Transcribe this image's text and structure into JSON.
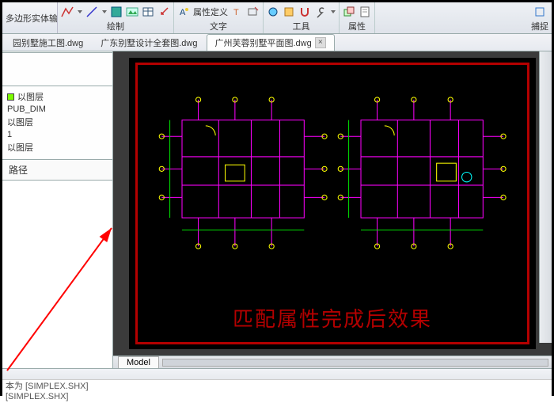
{
  "ribbon": {
    "left_label": "多边形实体输入",
    "groups": [
      {
        "label": "绘制",
        "icons": [
          "polyline-icon",
          "line-icon",
          "hatch-icon",
          "picture-icon",
          "table-icon",
          "arrow-icon"
        ]
      },
      {
        "label": "文字",
        "icons": [
          "attr-def-icon",
          "text-icon",
          "edit-text-icon"
        ],
        "attr_label": "属性定义"
      },
      {
        "label": "工具",
        "icons": [
          "tool1-icon",
          "tool2-icon",
          "magnet-icon",
          "wrench-icon"
        ]
      },
      {
        "label": "属性",
        "icons": [
          "block-icon",
          "props-icon"
        ]
      }
    ],
    "right_group_tiny": "捕捉"
  },
  "tabs": {
    "items": [
      {
        "label": "园别墅施工图.dwg",
        "active": false
      },
      {
        "label": "广东别墅设计全套图.dwg",
        "active": false
      },
      {
        "label": "广州芙蓉别墅平面图.dwg",
        "active": true
      }
    ]
  },
  "side": {
    "layers": [
      {
        "swatch": "#7CFC00",
        "name": "以图层"
      },
      {
        "swatch": "",
        "name": "PUB_DIM"
      },
      {
        "swatch": "",
        "name": "以图层"
      },
      {
        "swatch": "",
        "name": "1"
      },
      {
        "swatch": "",
        "name": "以图层"
      }
    ],
    "path_header": "路径"
  },
  "model_space": {
    "red_caption": "匹配属性完成后效果",
    "model_tab": "Model"
  },
  "log": {
    "line1": "本为 [SIMPLEX.SHX]",
    "line2": "[SIMPLEX.SHX]"
  },
  "colors": {
    "magenta": "#ff00ff",
    "yellow": "#ffff00",
    "green": "#00e000",
    "cyan": "#00ffff",
    "red": "#b40000"
  }
}
